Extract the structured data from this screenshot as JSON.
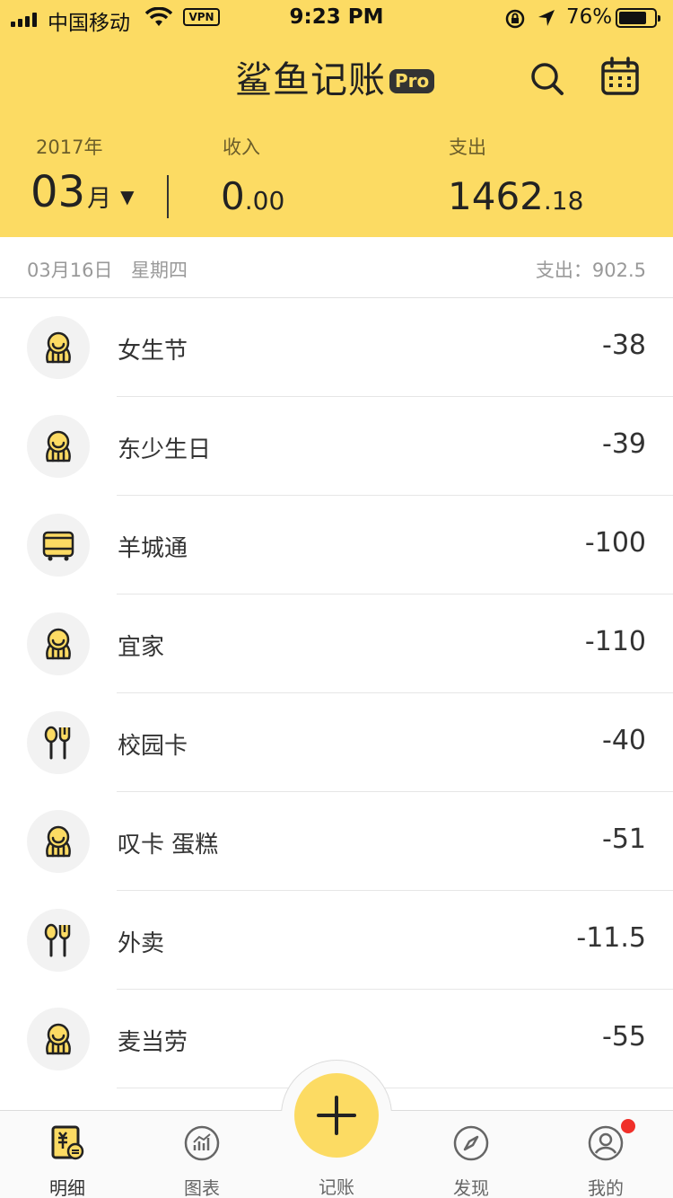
{
  "status_bar": {
    "carrier": "中国移动",
    "vpn": "VPN",
    "time": "9:23 PM",
    "battery": "76%"
  },
  "header": {
    "app_name": "鲨鱼记账",
    "badge": "Pro",
    "year": "2017年",
    "month_number": "03",
    "month_unit": "月",
    "month_caret": "▼",
    "income_label": "收入",
    "income_int": "0",
    "income_dec": ".00",
    "expense_label": "支出",
    "expense_int": "1462",
    "expense_dec": ".18"
  },
  "day_summary": {
    "date": "03月16日",
    "weekday": "星期四",
    "total": "支出：902.5"
  },
  "transactions": [
    {
      "icon": "social-icon",
      "title": "女生节",
      "amount": "-38"
    },
    {
      "icon": "social-icon",
      "title": "东少生日",
      "amount": "-39"
    },
    {
      "icon": "bus-icon",
      "title": "羊城通",
      "amount": "-100"
    },
    {
      "icon": "social-icon",
      "title": "宜家",
      "amount": "-110"
    },
    {
      "icon": "dining-icon",
      "title": "校园卡",
      "amount": "-40"
    },
    {
      "icon": "social-icon",
      "title": "叹卡 蛋糕",
      "amount": "-51"
    },
    {
      "icon": "dining-icon",
      "title": "外卖",
      "amount": "-11.5"
    },
    {
      "icon": "social-icon",
      "title": "麦当劳",
      "amount": "-55"
    }
  ],
  "tabbar": {
    "details": "明细",
    "charts": "图表",
    "add": "记账",
    "discover": "发现",
    "mine": "我的"
  },
  "colors": {
    "brand_yellow": "#fcdb63",
    "notification_red": "#f0302a"
  }
}
